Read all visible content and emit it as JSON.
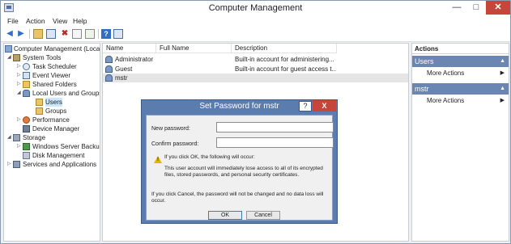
{
  "window": {
    "title": "Computer Management"
  },
  "menu": [
    "File",
    "Action",
    "View",
    "Help"
  ],
  "toolbar": {
    "icons": [
      "back-arrow-icon",
      "forward-arrow-icon",
      "up-folder-icon",
      "show-hide-tree-icon",
      "delete-icon",
      "properties-icon",
      "refresh-icon",
      "help-icon",
      "console-icon"
    ]
  },
  "tree": {
    "items": [
      {
        "label": "Computer Management (Local",
        "icon": "computer-management-icon"
      },
      {
        "label": "System Tools",
        "icon": "tools-icon"
      },
      {
        "label": "Task Scheduler",
        "icon": "clock-icon"
      },
      {
        "label": "Event Viewer",
        "icon": "event-viewer-icon"
      },
      {
        "label": "Shared Folders",
        "icon": "shared-folder-icon"
      },
      {
        "label": "Local Users and Groups",
        "icon": "users-icon"
      },
      {
        "label": "Users",
        "icon": "folder-icon"
      },
      {
        "label": "Groups",
        "icon": "folder-icon"
      },
      {
        "label": "Performance",
        "icon": "performance-icon"
      },
      {
        "label": "Device Manager",
        "icon": "device-manager-icon"
      },
      {
        "label": "Storage",
        "icon": "storage-icon"
      },
      {
        "label": "Windows Server Backup",
        "icon": "backup-icon"
      },
      {
        "label": "Disk Management",
        "icon": "disk-icon"
      },
      {
        "label": "Services and Applications",
        "icon": "services-icon"
      }
    ]
  },
  "list": {
    "columns": [
      "Name",
      "Full Name",
      "Description"
    ],
    "rows": [
      {
        "name": "Administrator",
        "full_name": "",
        "description": "Built-in account for administering..."
      },
      {
        "name": "Guest",
        "full_name": "",
        "description": "Built-in account for guest access t..."
      },
      {
        "name": "mstr",
        "full_name": "",
        "description": ""
      }
    ]
  },
  "actions": {
    "header": "Actions",
    "sections": [
      {
        "title": "Users",
        "item": "More Actions"
      },
      {
        "title": "mstr",
        "item": "More Actions"
      }
    ]
  },
  "dialog": {
    "title": "Set Password for mstr",
    "help": "?",
    "close": "X",
    "new_password_label": "New password:",
    "confirm_password_label": "Confirm password:",
    "new_password_value": "",
    "confirm_password_value": "",
    "ok_heading": "If you click OK, the following will occur:",
    "ok_detail_1": "This user account will immediately lose access to all of its encrypted",
    "ok_detail_2": "files, stored passwords, and personal security certificates.",
    "cancel_text_1": "If you click Cancel, the password will not be changed and no data loss will",
    "cancel_text_2": "occur.",
    "ok_button": "OK",
    "cancel_button": "Cancel"
  }
}
